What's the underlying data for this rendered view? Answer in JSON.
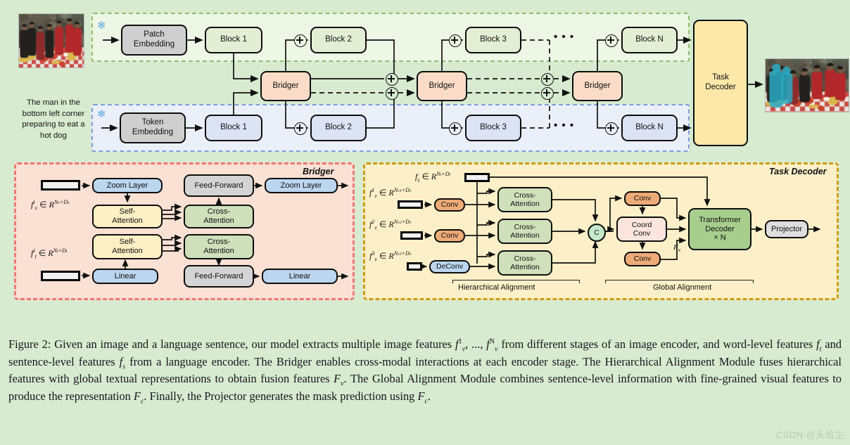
{
  "figure": {
    "label": "Figure 2",
    "caption_parts": {
      "s1": "Figure 2: Given an image and a language sentence, our model extracts multiple image features ",
      "m1": "f",
      "m1_sub": "v",
      "m1_sup": "1",
      "s2": ", ..., ",
      "m2": "f",
      "m2_sub": "v",
      "m2_sup": "N",
      "s3": " from different stages of an image encoder, and word-level features ",
      "m3": "f",
      "m3_sub": "t",
      "s4": " and sentence-level features ",
      "m4": "f",
      "m4_sub": "s",
      "s5": " from a language encoder. The Bridger enables cross-modal interactions at each encoder stage. The Hierarchical Alignment Module fuses hierarchical features with global textual representations to obtain fusion features ",
      "m5": "F",
      "m5_sub": "v",
      "s6": ". The Global Alignment Module combines sentence-level information with fine-grained visual features to produce the representation ",
      "m6": "F",
      "m6_sub": "c",
      "s7": ". Finally, the Projector generates the mask prediction using ",
      "m7": "F",
      "m7_sub": "c",
      "s8": "."
    },
    "watermark": "CSDN @头给尘"
  },
  "inputs": {
    "image_alt": "street food scene photo",
    "sentence": "The man in\nthe bottom\nleft corner\npreparing to\neat a hot dog",
    "output_image_alt": "street food scene with cyan segmentation mask on person at bottom left"
  },
  "encoder": {
    "visual_branch": {
      "frozen_icon": "snowflake-icon",
      "embedding": "Patch\nEmbedding",
      "blocks": [
        "Block 1",
        "Block 2",
        "Block 3",
        "Block N"
      ],
      "ellipsis": "• • •"
    },
    "text_branch": {
      "frozen_icon": "snowflake-icon",
      "embedding": "Token\nEmbedding",
      "blocks": [
        "Block 1",
        "Block 2",
        "Block 3",
        "Block N"
      ],
      "ellipsis": "• • •"
    },
    "bridgers": [
      "Bridger",
      "Bridger",
      "Bridger"
    ],
    "task_decoder": "Task\nDecoder",
    "add_symbol": "⊕"
  },
  "bridger_panel": {
    "title": "Bridger",
    "input_visual": {
      "f": "f",
      "sup": "i",
      "sub": "v",
      "space": "R",
      "dim1": "N",
      "dim1sub": "v",
      "dim2": "D",
      "dim2sub": "v"
    },
    "input_text": {
      "f": "f",
      "sup": "i",
      "sub": "t",
      "space": "R",
      "dim1": "N",
      "dim1sub": "t",
      "dim2": "D",
      "dim2sub": "t"
    },
    "nodes": {
      "zoom_layer_in": "Zoom Layer",
      "zoom_layer_out": "Zoom Layer",
      "linear_in": "Linear",
      "linear_out": "Linear",
      "self_attention_v": "Self-\nAttention",
      "self_attention_t": "Self-\nAttention",
      "cross_attention_v": "Cross-\nAttention",
      "cross_attention_t": "Cross-\nAttention",
      "feed_forward_top": "Feed-Forward",
      "feed_forward_bottom": "Feed-Forward"
    }
  },
  "decoder_panel": {
    "title": "Task Decoder",
    "sentence_feature": {
      "f": "f",
      "sub": "s",
      "space": "R",
      "dim1": "N",
      "dim1sub": "t",
      "dim2": "D",
      "dim2sub": "t"
    },
    "visual_features": [
      {
        "f": "f",
        "sub": "v",
        "sup": "1",
        "space": "R",
        "dim1": "N",
        "dim1sub": "v",
        "dim1sup": "1",
        "dim2": "D",
        "dim2sub": "v"
      },
      {
        "f": "f",
        "sub": "v",
        "sup": "2",
        "space": "R",
        "dim1": "N",
        "dim1sub": "v",
        "dim1sup": "2",
        "dim2": "D",
        "dim2sub": "v"
      },
      {
        "f": "f",
        "sub": "v",
        "sup": "3",
        "space": "R",
        "dim1": "N",
        "dim1sub": "v",
        "dim1sup": "3",
        "dim2": "D",
        "dim2sub": "v"
      }
    ],
    "ops": {
      "conv1": "Conv",
      "conv2": "Conv",
      "deconv": "DeConv",
      "cross_attention_1": "Cross-\nAttention",
      "cross_attention_2": "Cross-\nAttention",
      "cross_attention_3": "Cross-\nAttention",
      "concat": "C",
      "conv_top": "Conv",
      "coord_conv": "Coord\nConv",
      "conv_bottom": "Conv",
      "transformer_decoder": "Transformer\nDecoder\n× N",
      "projector": "Projector"
    },
    "fv_label": {
      "f": "F",
      "sub": "v"
    },
    "group_labels": {
      "hierarchical": "Hierarchical Alignment",
      "global": "Global Alignment"
    }
  },
  "colors": {
    "background": "#d6ebd0",
    "visual_panel": "#eef6e6",
    "visual_panel_border": "#8fbf6a",
    "text_panel": "#eaeff9",
    "text_panel_border": "#7f9fd8",
    "bridger_panel": "#fbe0d4",
    "bridger_panel_border": "#f1776f",
    "decoder_panel": "#fdf0c8",
    "decoder_panel_border": "#cf9c16",
    "bridger_node": "#fbddc7",
    "task_decoder_node": "#fde8a8",
    "block_visual": "#e4eed5",
    "block_text": "#dbe3f4",
    "embedding_node": "#cfcfcf",
    "attention_node": "#cfe0bb",
    "self_attention_node": "#fdf0c4",
    "conv_node": "#edab77",
    "transformer_node": "#a8ce8d",
    "snowflake": "#59a8de",
    "mask_overlay": "#3fb6cf"
  }
}
